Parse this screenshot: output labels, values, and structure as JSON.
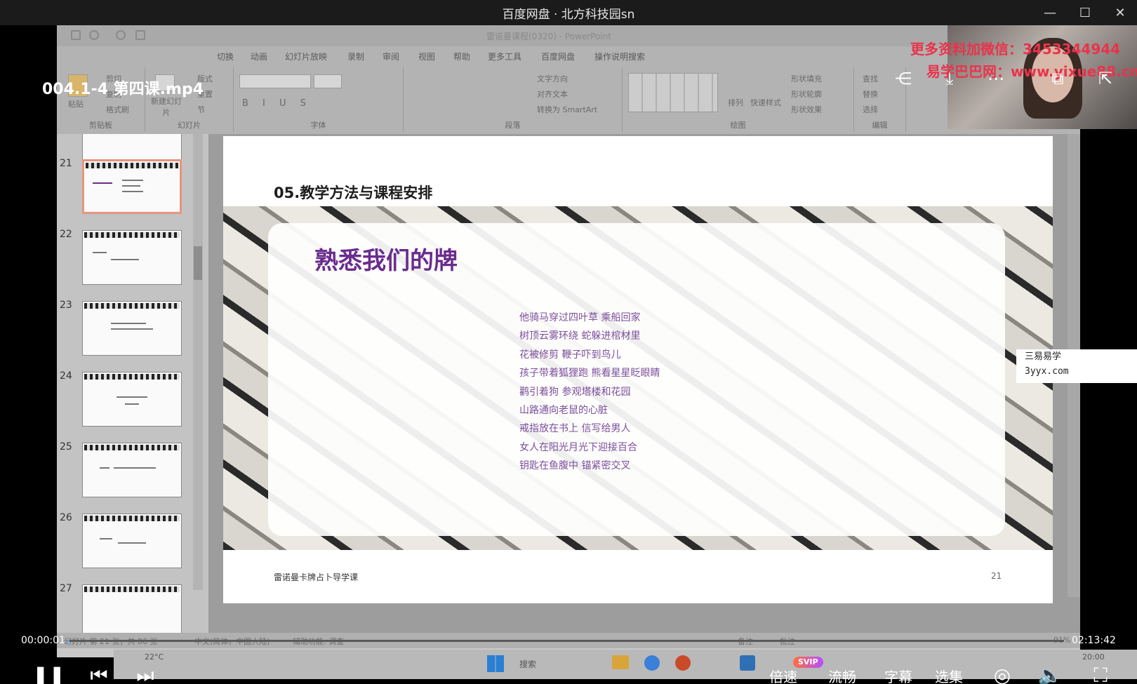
{
  "window": {
    "title": "百度网盘 · 北方科技园sn"
  },
  "player": {
    "filename": "004.1-4 第四课.mp4",
    "time_current": "00:00:01",
    "time_total": "02:13:42",
    "progress": 0.0001,
    "speed_label": "倍速",
    "quality_label": "流畅",
    "subtitle_label": "字幕",
    "episodes_label": "选集",
    "svip_badge": "SVIP"
  },
  "watermarks": {
    "line1": "更多资料加微信：3453344944",
    "line2": "易学巴巴网：www.yixue88.cn",
    "box_line1": "三易易学",
    "box_line2": "3yyx.com"
  },
  "powerpoint": {
    "window_title": "雷诺曼课程(0320) - PowerPoint",
    "menus": [
      "切换",
      "动画",
      "幻灯片放映",
      "录制",
      "审阅",
      "视图",
      "帮助",
      "更多工具",
      "百度网盘",
      "操作说明搜索"
    ],
    "groups": [
      "剪贴板",
      "幻灯片",
      "字体",
      "段落",
      "绘图",
      "编辑"
    ],
    "clipboard": {
      "paste": "粘贴",
      "cut": "剪切",
      "copy": "复制",
      "format_painter": "格式刷"
    },
    "slides_group": {
      "new_slide": "新建幻灯片",
      "layout": "版式",
      "reset": "重置",
      "section": "节"
    },
    "paragraph_group": {
      "text_direction": "文字方向",
      "align_text": "对齐文本",
      "smartart": "转换为 SmartArt"
    },
    "drawing_group": {
      "arrange": "排列",
      "quick_styles": "快速样式",
      "shape_fill": "形状填充",
      "shape_outline": "形状轮廓",
      "shape_effects": "形状效果"
    },
    "editing_group": {
      "find": "查找",
      "replace": "替换",
      "select": "选择"
    },
    "thumbnail_numbers": [
      "21",
      "22",
      "23",
      "24",
      "25",
      "26",
      "27"
    ],
    "status": {
      "slide_info": "幻灯片 第 21 张，共 86 张",
      "language": "中文(简体，中国大陆)",
      "accessibility": "辅助功能: 调查",
      "notes": "备注",
      "comments": "批注",
      "zoom": "91%"
    }
  },
  "slide": {
    "heading": "05.教学方法与课程安排",
    "card_title": "熟悉我们的牌",
    "lines": [
      "他骑马穿过四叶草    乘船回家",
      "树顶云雾环绕    蛇躲进棺材里",
      "花被修剪    鞭子吓到鸟儿",
      "孩子带着狐狸跑    熊看星星眨眼睛",
      "鹳引着狗    参观塔楼和花园",
      "山路通向老鼠的心脏",
      "戒指放在书上    信写给男人",
      "女人在阳光月光下迎接百合",
      "钥匙在鱼腹中    锚紧密交叉"
    ],
    "footer": "雷诺曼卡牌占卜导学课",
    "page_number": "21"
  },
  "taskbar": {
    "weather": "22°C",
    "search": "搜索",
    "clock": "20:00"
  },
  "colors": {
    "accent_purple": "#6a2c8e",
    "line_purple": "#7c4e9c",
    "watermark_red": "#e8344b",
    "progress": "#4aa3ff"
  }
}
